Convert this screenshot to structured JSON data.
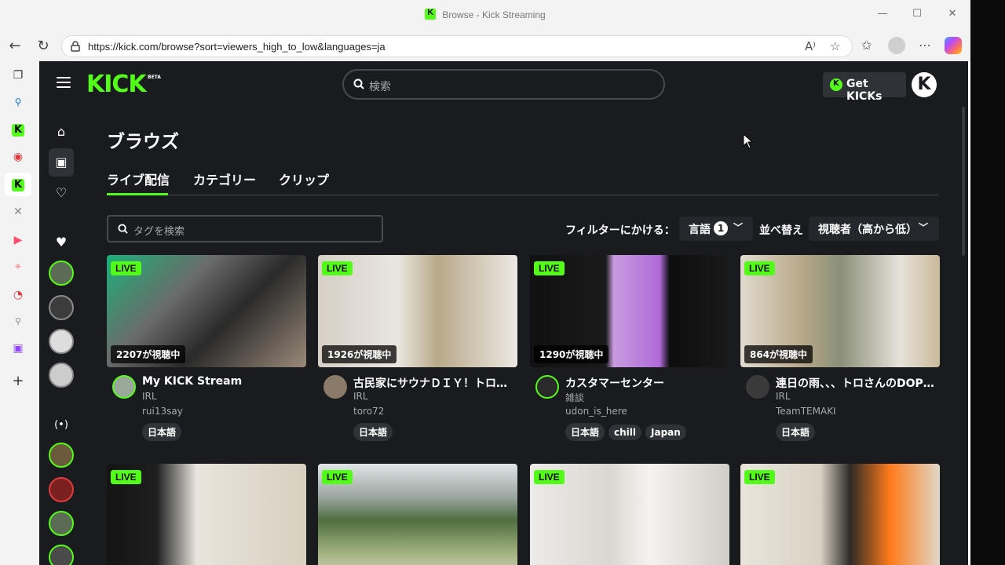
{
  "window": {
    "title": "Browse - Kick Streaming"
  },
  "browser": {
    "url": "https://kick.com/browse?sort=viewers_high_to_low&languages=ja",
    "read_aloud_label": "A⁾"
  },
  "header": {
    "logo": "KICK",
    "beta": "BETA",
    "search_placeholder": "検索",
    "get_kicks": "Get KICKs",
    "user_initial": "K"
  },
  "page": {
    "heading": "ブラウズ",
    "tabs": [
      {
        "label": "ライブ配信",
        "active": true
      },
      {
        "label": "カテゴリー"
      },
      {
        "label": "クリップ"
      }
    ],
    "tag_search_placeholder": "タグを検索",
    "filter_label": "フィルターにかける：",
    "language_button": {
      "label": "言語",
      "count": "1"
    },
    "sort_label": "並べ替え",
    "sort_button": {
      "label": "視聴者（高から低）"
    }
  },
  "colors": {
    "accent": "#53fc18",
    "background": "#191b1f",
    "chip": "#2f3237",
    "muted_text": "#a7a9ad"
  },
  "streams": [
    {
      "live": "LIVE",
      "viewers": "2207が視聴中",
      "title": "My KICK Stream",
      "category": "IRL",
      "channel": "rui13say",
      "tags": [
        "日本語"
      ]
    },
    {
      "live": "LIVE",
      "viewers": "1926が視聴中",
      "title": "古民家にサウナＤＩＹ！トロさんのDOPE DIY",
      "category": "IRL",
      "channel": "toro72",
      "tags": [
        "日本語"
      ]
    },
    {
      "live": "LIVE",
      "viewers": "1290が視聴中",
      "title": "カスタマーセンター",
      "category": "雑談",
      "channel": "udon_is_here",
      "tags": [
        "日本語",
        "chill",
        "Japan"
      ]
    },
    {
      "live": "LIVE",
      "viewers": "864が視聴中",
      "title": "連日の雨、、、トロさんのDOPE DIY",
      "category": "IRL",
      "channel": "TeamTEMAKI",
      "tags": [
        "日本語"
      ]
    },
    {
      "live": "LIVE"
    },
    {
      "live": "LIVE"
    },
    {
      "live": "LIVE"
    },
    {
      "live": "LIVE"
    }
  ]
}
